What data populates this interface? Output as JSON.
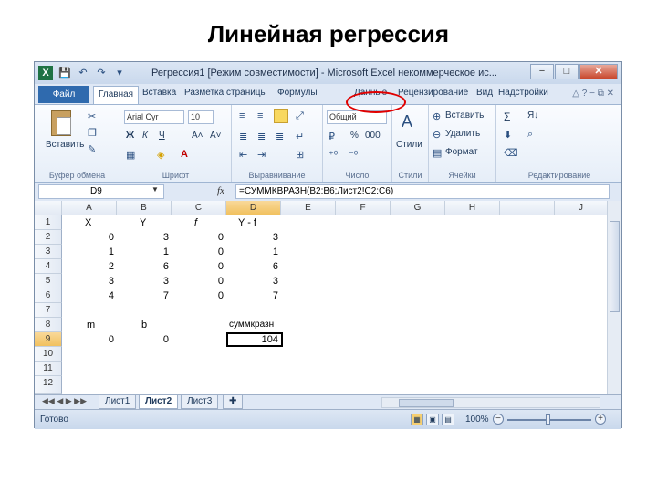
{
  "slide": {
    "title": "Линейная регрессия"
  },
  "window": {
    "title": "Регрессия1  [Режим совместимости]  -  Microsoft Excel некоммерческое ис...",
    "btn_minimize": "−",
    "btn_maximize": "□",
    "btn_close": "✕",
    "qat": {
      "save": "💾",
      "undo": "↶",
      "redo": "↷",
      "customize": "▾"
    }
  },
  "tabs": {
    "file": "Файл",
    "home": "Главная",
    "insert": "Вставка",
    "page_layout": "Разметка страницы",
    "formulas": "Формулы",
    "data": "Данные",
    "review": "Рецензирование",
    "view": "Вид",
    "addins": "Надстройки",
    "help_icons": "△  ?  −  ⧉  ✕"
  },
  "ribbon": {
    "clipboard": {
      "label": "Буфер обмена",
      "paste": "Вставить"
    },
    "font": {
      "label": "Шрифт",
      "font_name": "Arial Cyr",
      "font_size": "10",
      "bold": "Ж",
      "italic": "К",
      "underline": "Ч",
      "grow": "A˄",
      "shrink": "A˅"
    },
    "alignment": {
      "label": "Выравнивание"
    },
    "number": {
      "label": "Число",
      "format": "Общий",
      "percent": "%",
      "thousands": "000"
    },
    "styles": {
      "label": "Стили",
      "styles_button": "Стили"
    },
    "cells": {
      "label": "Ячейки",
      "insert": "Вставить",
      "delete": "Удалить",
      "format": "Формат"
    },
    "editing": {
      "label": "Редактирование",
      "sum": "Σ",
      "sort": "Я↓"
    }
  },
  "formula_bar": {
    "name_box": "D9",
    "fx": "fx",
    "formula": "=СУММКВРАЗН(B2:B6;Лист2!C2:C6)"
  },
  "grid": {
    "columns": [
      "A",
      "B",
      "C",
      "D",
      "E",
      "F",
      "G",
      "H",
      "I",
      "J"
    ],
    "row_numbers": [
      "1",
      "2",
      "3",
      "4",
      "5",
      "6",
      "7",
      "8",
      "9",
      "10",
      "11",
      "12"
    ],
    "selected_column": "D",
    "selected_row": "9",
    "header_row": {
      "A": "X",
      "B": "Y",
      "C": "f",
      "D": "Y - f"
    },
    "data_rows": [
      {
        "A": "0",
        "B": "3",
        "C": "0",
        "D": "3"
      },
      {
        "A": "1",
        "B": "1",
        "C": "0",
        "D": "1"
      },
      {
        "A": "2",
        "B": "6",
        "C": "0",
        "D": "6"
      },
      {
        "A": "3",
        "B": "3",
        "C": "0",
        "D": "3"
      },
      {
        "A": "4",
        "B": "7",
        "C": "0",
        "D": "7"
      }
    ],
    "label_row": {
      "A": "m",
      "B": "b",
      "D": "суммкразн"
    },
    "value_row": {
      "A": "0",
      "B": "0",
      "D": "104"
    }
  },
  "sheets": {
    "nav": "◀◀  ◀  ▶  ▶▶",
    "tabs": [
      "Лист1",
      "Лист2",
      "Лист3"
    ],
    "active": "Лист2",
    "new_sheet": "✚"
  },
  "status": {
    "ready": "Готово",
    "zoom": "100%",
    "zoom_minus": "−",
    "zoom_plus": "+"
  },
  "annotation": {
    "color": "#e00000"
  }
}
